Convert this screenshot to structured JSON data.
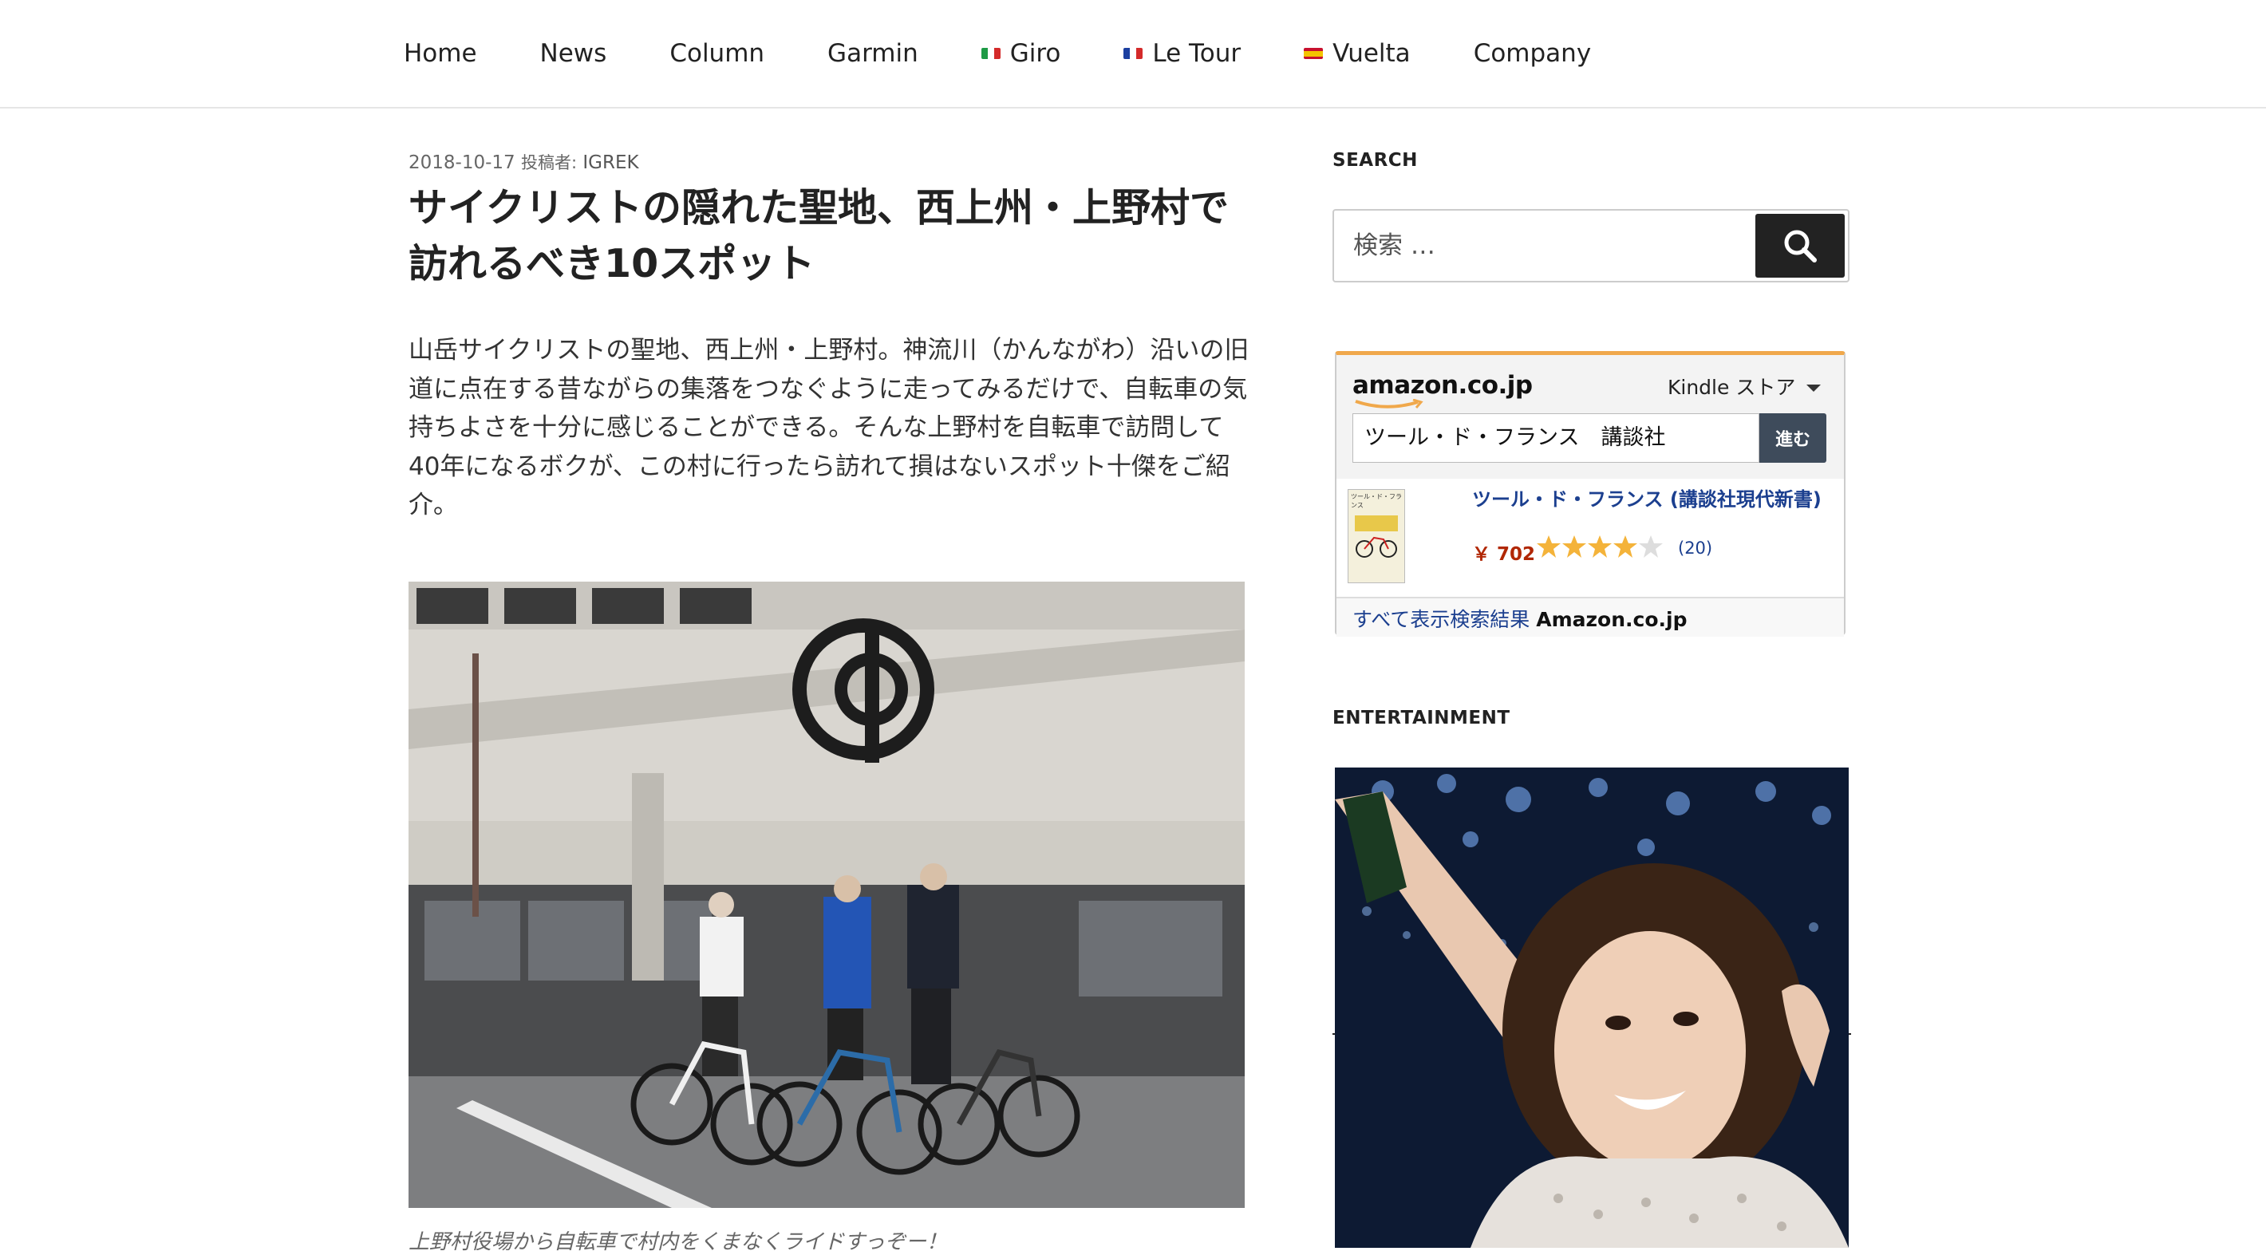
{
  "nav": {
    "items": [
      {
        "label": "Home",
        "flag": ""
      },
      {
        "label": "News",
        "flag": ""
      },
      {
        "label": "Column",
        "flag": ""
      },
      {
        "label": "Garmin",
        "flag": ""
      },
      {
        "label": "Giro",
        "flag": "italy"
      },
      {
        "label": "Le Tour",
        "flag": "france"
      },
      {
        "label": "Vuelta",
        "flag": "spain"
      },
      {
        "label": "Company",
        "flag": ""
      }
    ]
  },
  "article": {
    "date": "2018-10-17",
    "author_label": "投稿者:",
    "author": "IGREK",
    "title": "サイクリストの隠れた聖地、西上州・上野村で訪れるべき10スポット",
    "lead": "山岳サイクリストの聖地、西上州・上野村。神流川（かんながわ）沿いの旧道に点在する昔ながらの集落をつなぐように走ってみるだけで、自転車の気持ちよさを十分に感じることができる。そんな上野村を自転車で訪問して40年になるボクが、この村に行ったら訪れて損はないスポット十傑をご紹介。",
    "photo_icon": "cyclists-at-village-office-photo",
    "caption": "上野村役場から自転車で村内をくまなくライドすっぞー！"
  },
  "sidebar": {
    "search": {
      "title": "SEARCH",
      "placeholder": "検索 …"
    },
    "amazon": {
      "logo": "amazon.co.jp",
      "store": "Kindle ストア",
      "query": "ツール・ド・フランス　講談社",
      "go_label": "進む",
      "book_cover_title": "ツール・ド・フランス",
      "product_title": "ツール・ド・フランス (講談社現代新書)",
      "price": "￥ 702",
      "rating": 4,
      "review_count": "(20)",
      "all_results_prefix": "すべて表示検索結果",
      "all_results_site": "Amazon.co.jp",
      "accent": "#f0a84b"
    },
    "entertainment": {
      "title": "ENTERTAINMENT",
      "image_icon": "singer-on-stage-photo"
    }
  }
}
